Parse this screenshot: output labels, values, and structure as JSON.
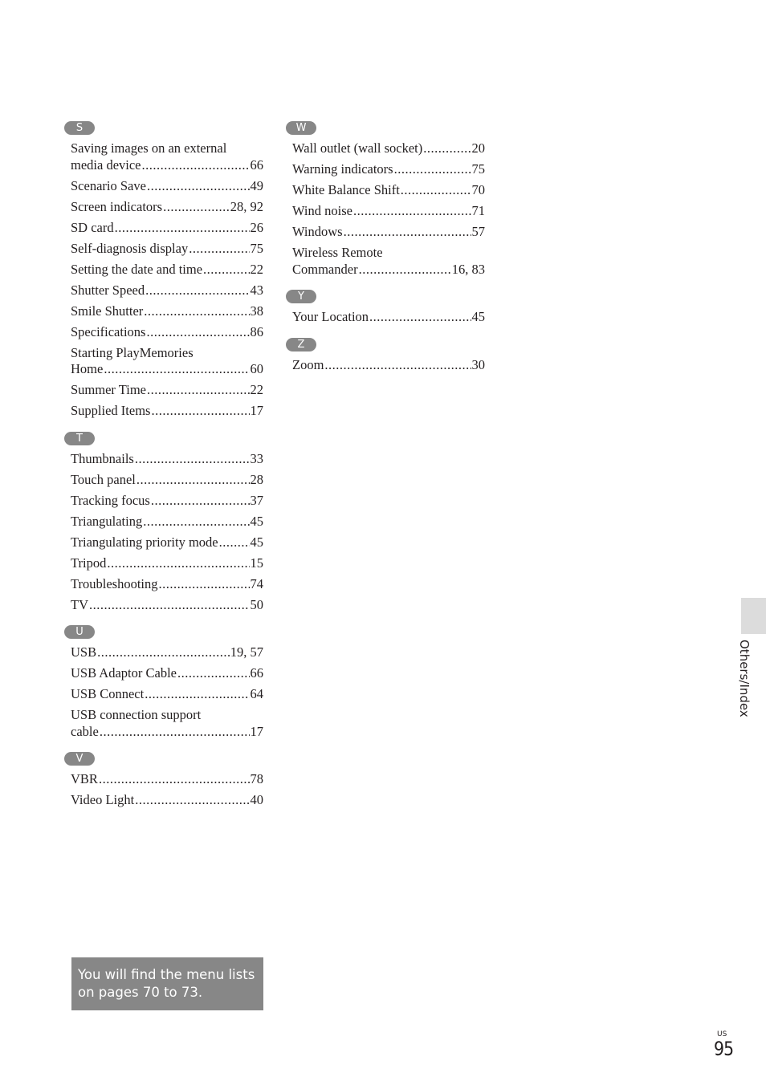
{
  "index": {
    "left_column": [
      {
        "letter": "S",
        "entries": [
          {
            "line1": "Saving images on an external",
            "term": "media device",
            "pages": "66"
          },
          {
            "term": "Scenario Save",
            "pages": "49"
          },
          {
            "term": "Screen indicators",
            "pages": "28, 92"
          },
          {
            "term": "SD card",
            "pages": "26"
          },
          {
            "term": "Self-diagnosis display",
            "pages": "75"
          },
          {
            "term": "Setting the date and time",
            "pages": "22"
          },
          {
            "term": "Shutter Speed",
            "pages": "43"
          },
          {
            "term": "Smile Shutter",
            "pages": "38"
          },
          {
            "term": "Specifications",
            "pages": "86"
          },
          {
            "line1": "Starting PlayMemories",
            "term": "Home",
            "pages": "60"
          },
          {
            "term": "Summer Time",
            "pages": "22"
          },
          {
            "term": "Supplied Items",
            "pages": "17"
          }
        ]
      },
      {
        "letter": "T",
        "entries": [
          {
            "term": "Thumbnails",
            "pages": "33"
          },
          {
            "term": "Touch panel",
            "pages": "28"
          },
          {
            "term": "Tracking focus",
            "pages": "37"
          },
          {
            "term": "Triangulating",
            "pages": "45"
          },
          {
            "term": "Triangulating priority mode",
            "pages": "45"
          },
          {
            "term": "Tripod",
            "pages": "15"
          },
          {
            "term": "Troubleshooting",
            "pages": "74"
          },
          {
            "term": "TV",
            "pages": "50"
          }
        ]
      },
      {
        "letter": "U",
        "entries": [
          {
            "term": "USB",
            "pages": "19, 57"
          },
          {
            "term": "USB Adaptor Cable",
            "pages": "66"
          },
          {
            "term": "USB Connect",
            "pages": "64"
          },
          {
            "line1": "USB connection support",
            "term": "cable",
            "pages": "17"
          }
        ]
      },
      {
        "letter": "V",
        "entries": [
          {
            "term": "VBR",
            "pages": "78"
          },
          {
            "term": "Video Light",
            "pages": "40"
          }
        ]
      }
    ],
    "right_column": [
      {
        "letter": "W",
        "entries": [
          {
            "term": "Wall outlet (wall socket)",
            "pages": "20"
          },
          {
            "term": "Warning indicators",
            "pages": "75"
          },
          {
            "term": "White Balance Shift",
            "pages": "70"
          },
          {
            "term": "Wind noise",
            "pages": "71"
          },
          {
            "term": "Windows",
            "pages": "57"
          },
          {
            "line1": "Wireless Remote",
            "term": "Commander",
            "pages": "16, 83"
          }
        ]
      },
      {
        "letter": "Y",
        "entries": [
          {
            "term": "Your Location",
            "pages": "45"
          }
        ]
      },
      {
        "letter": "Z",
        "entries": [
          {
            "term": "Zoom",
            "pages": "30"
          }
        ]
      }
    ]
  },
  "note": "You will find the menu lists on pages 70 to 73.",
  "side_tab": {
    "label": "Others/Index"
  },
  "footer": {
    "region": "US",
    "page_number": "95"
  },
  "colors": {
    "badge": "#878787",
    "note_box": "#878787",
    "side_tab": "#dcdcdc",
    "text": "#231f20"
  }
}
